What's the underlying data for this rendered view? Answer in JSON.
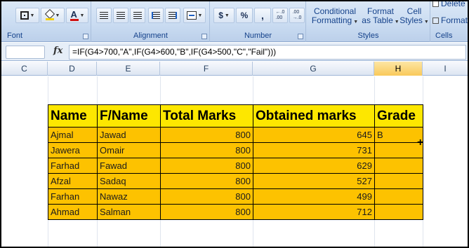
{
  "ribbon": {
    "groups": {
      "font": "Font",
      "alignment": "Alignment",
      "number": "Number",
      "styles": "Styles",
      "cells": "Cells"
    },
    "number": {
      "currency": "$",
      "percent": "%",
      "comma": ",",
      "inc_decimal": "←.0\n.00",
      "dec_decimal": ".00\n→.0"
    },
    "font_color_letter": "A",
    "styles": {
      "conditional": [
        "Conditional",
        "Formatting"
      ],
      "format_table": [
        "Format",
        "as Table"
      ],
      "cell_styles": [
        "Cell",
        "Styles"
      ]
    },
    "cells": {
      "delete": "Delete",
      "format": "Format"
    }
  },
  "formula_bar": {
    "fx": "fx",
    "formula": "=IF(G4>700,\"A\",IF(G4>600,\"B\",IF(G4>500,\"C\",\"Fail\")))"
  },
  "columns": [
    "C",
    "D",
    "E",
    "F",
    "G",
    "H",
    "I"
  ],
  "active_column": "H",
  "table": {
    "headers": [
      "Name",
      "F/Name",
      "Total Marks",
      "Obtained marks",
      "Grade"
    ],
    "rows": [
      {
        "name": "Ajmal",
        "fname": "Jawad",
        "total": "800",
        "obtained": "645",
        "grade": "B"
      },
      {
        "name": "Jawera",
        "fname": "Omair",
        "total": "800",
        "obtained": "731",
        "grade": ""
      },
      {
        "name": "Farhad",
        "fname": "Fawad",
        "total": "800",
        "obtained": "629",
        "grade": ""
      },
      {
        "name": "Afzal",
        "fname": "Sadaq",
        "total": "800",
        "obtained": "527",
        "grade": ""
      },
      {
        "name": "Farhan",
        "fname": "Nawaz",
        "total": "800",
        "obtained": "499",
        "grade": ""
      },
      {
        "name": "Ahmad",
        "fname": "Salman",
        "total": "800",
        "obtained": "712",
        "grade": ""
      }
    ]
  },
  "colors": {
    "header_fill": "#fde700",
    "cell_fill": "#fdc200",
    "ribbon": "#c9dbf1"
  }
}
